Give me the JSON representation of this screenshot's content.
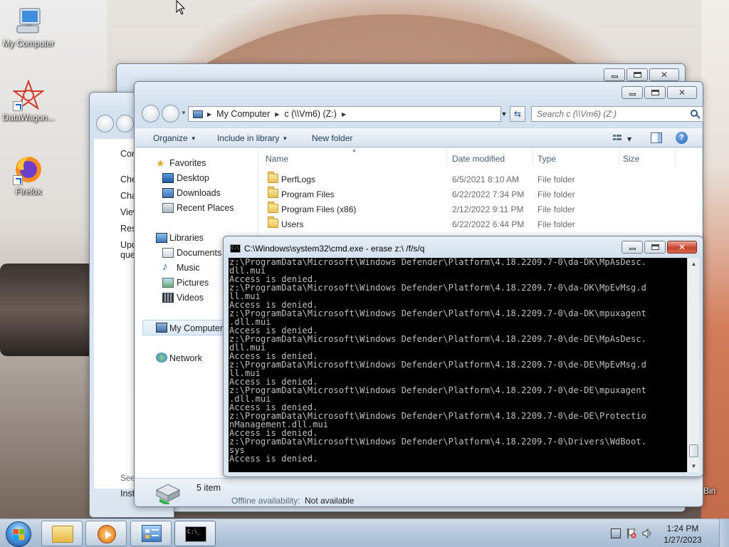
{
  "desktop": {
    "icons": [
      {
        "label": "My Computer",
        "icon": "computer-icon"
      },
      {
        "label": "DataWagon...",
        "icon": "datawagon-icon"
      },
      {
        "label": "Firefox",
        "icon": "firefox-icon"
      }
    ],
    "partial_bin_label": "Bin"
  },
  "back_window": {
    "texts": [
      "Cont",
      "Chec",
      "Chan",
      "View",
      "Resto",
      "Upda",
      "quest",
      "See a",
      "Insta"
    ]
  },
  "explorer": {
    "breadcrumb": [
      "My Computer",
      "c (\\\\Vm6) (Z:)"
    ],
    "search_placeholder": "Search c (\\\\Vm6) (Z:)",
    "toolbar": {
      "organize": "Organize",
      "include_in_library": "Include in library",
      "new_folder": "New folder"
    },
    "nav": {
      "favorites": "Favorites",
      "favorites_items": [
        "Desktop",
        "Downloads",
        "Recent Places"
      ],
      "libraries": "Libraries",
      "libraries_items": [
        "Documents",
        "Music",
        "Pictures",
        "Videos"
      ],
      "my_computer": "My Computer",
      "network": "Network"
    },
    "columns": {
      "name": "Name",
      "date_modified": "Date modified",
      "type": "Type",
      "size": "Size"
    },
    "files": [
      {
        "name": "PerfLogs",
        "date": "6/5/2021 8:10 AM",
        "type": "File folder"
      },
      {
        "name": "Program Files",
        "date": "6/22/2022 7:34 PM",
        "type": "File folder"
      },
      {
        "name": "Program Files (x86)",
        "date": "2/12/2022 9:11 PM",
        "type": "File folder"
      },
      {
        "name": "Users",
        "date": "6/22/2022 6:44 PM",
        "type": "File folder"
      }
    ],
    "details": {
      "item_count": "5 item",
      "offline_label": "Offline availability:",
      "offline_value": "Not available"
    }
  },
  "cmd": {
    "title": "C:\\Windows\\system32\\cmd.exe - erase  z:\\ /f/s/q",
    "output": "z:\\ProgramData\\Microsoft\\Windows Defender\\Platform\\4.18.2209.7-0\\da-DK\\MpAsDesc.\ndll.mui\nAccess is denied.\nz:\\ProgramData\\Microsoft\\Windows Defender\\Platform\\4.18.2209.7-0\\da-DK\\MpEvMsg.d\nll.mui\nAccess is denied.\nz:\\ProgramData\\Microsoft\\Windows Defender\\Platform\\4.18.2209.7-0\\da-DK\\mpuxagent\n.dll.mui\nAccess is denied.\nz:\\ProgramData\\Microsoft\\Windows Defender\\Platform\\4.18.2209.7-0\\de-DE\\MpAsDesc.\ndll.mui\nAccess is denied.\nz:\\ProgramData\\Microsoft\\Windows Defender\\Platform\\4.18.2209.7-0\\de-DE\\MpEvMsg.d\nll.mui\nAccess is denied.\nz:\\ProgramData\\Microsoft\\Windows Defender\\Platform\\4.18.2209.7-0\\de-DE\\mpuxagent\n.dll.mui\nAccess is denied.\nz:\\ProgramData\\Microsoft\\Windows Defender\\Platform\\4.18.2209.7-0\\de-DE\\Protectio\nnManagement.dll.mui\nAccess is denied.\nz:\\ProgramData\\Microsoft\\Windows Defender\\Platform\\4.18.2209.7-0\\Drivers\\WdBoot.\nsys\nAccess is denied."
  },
  "taskbar": {
    "buttons": [
      "start-button",
      "explorer-taskbar-button",
      "media-player-taskbar-button",
      "control-panel-taskbar-button",
      "cmd-taskbar-button"
    ],
    "clock": {
      "time": "1:24 PM",
      "date": "1/27/2023"
    }
  },
  "colors": {
    "cmd_background": "#000000",
    "cmd_text": "#c0c0c0",
    "window_frame": "#d4e1ee",
    "taskbar": "#b7c9dc"
  }
}
